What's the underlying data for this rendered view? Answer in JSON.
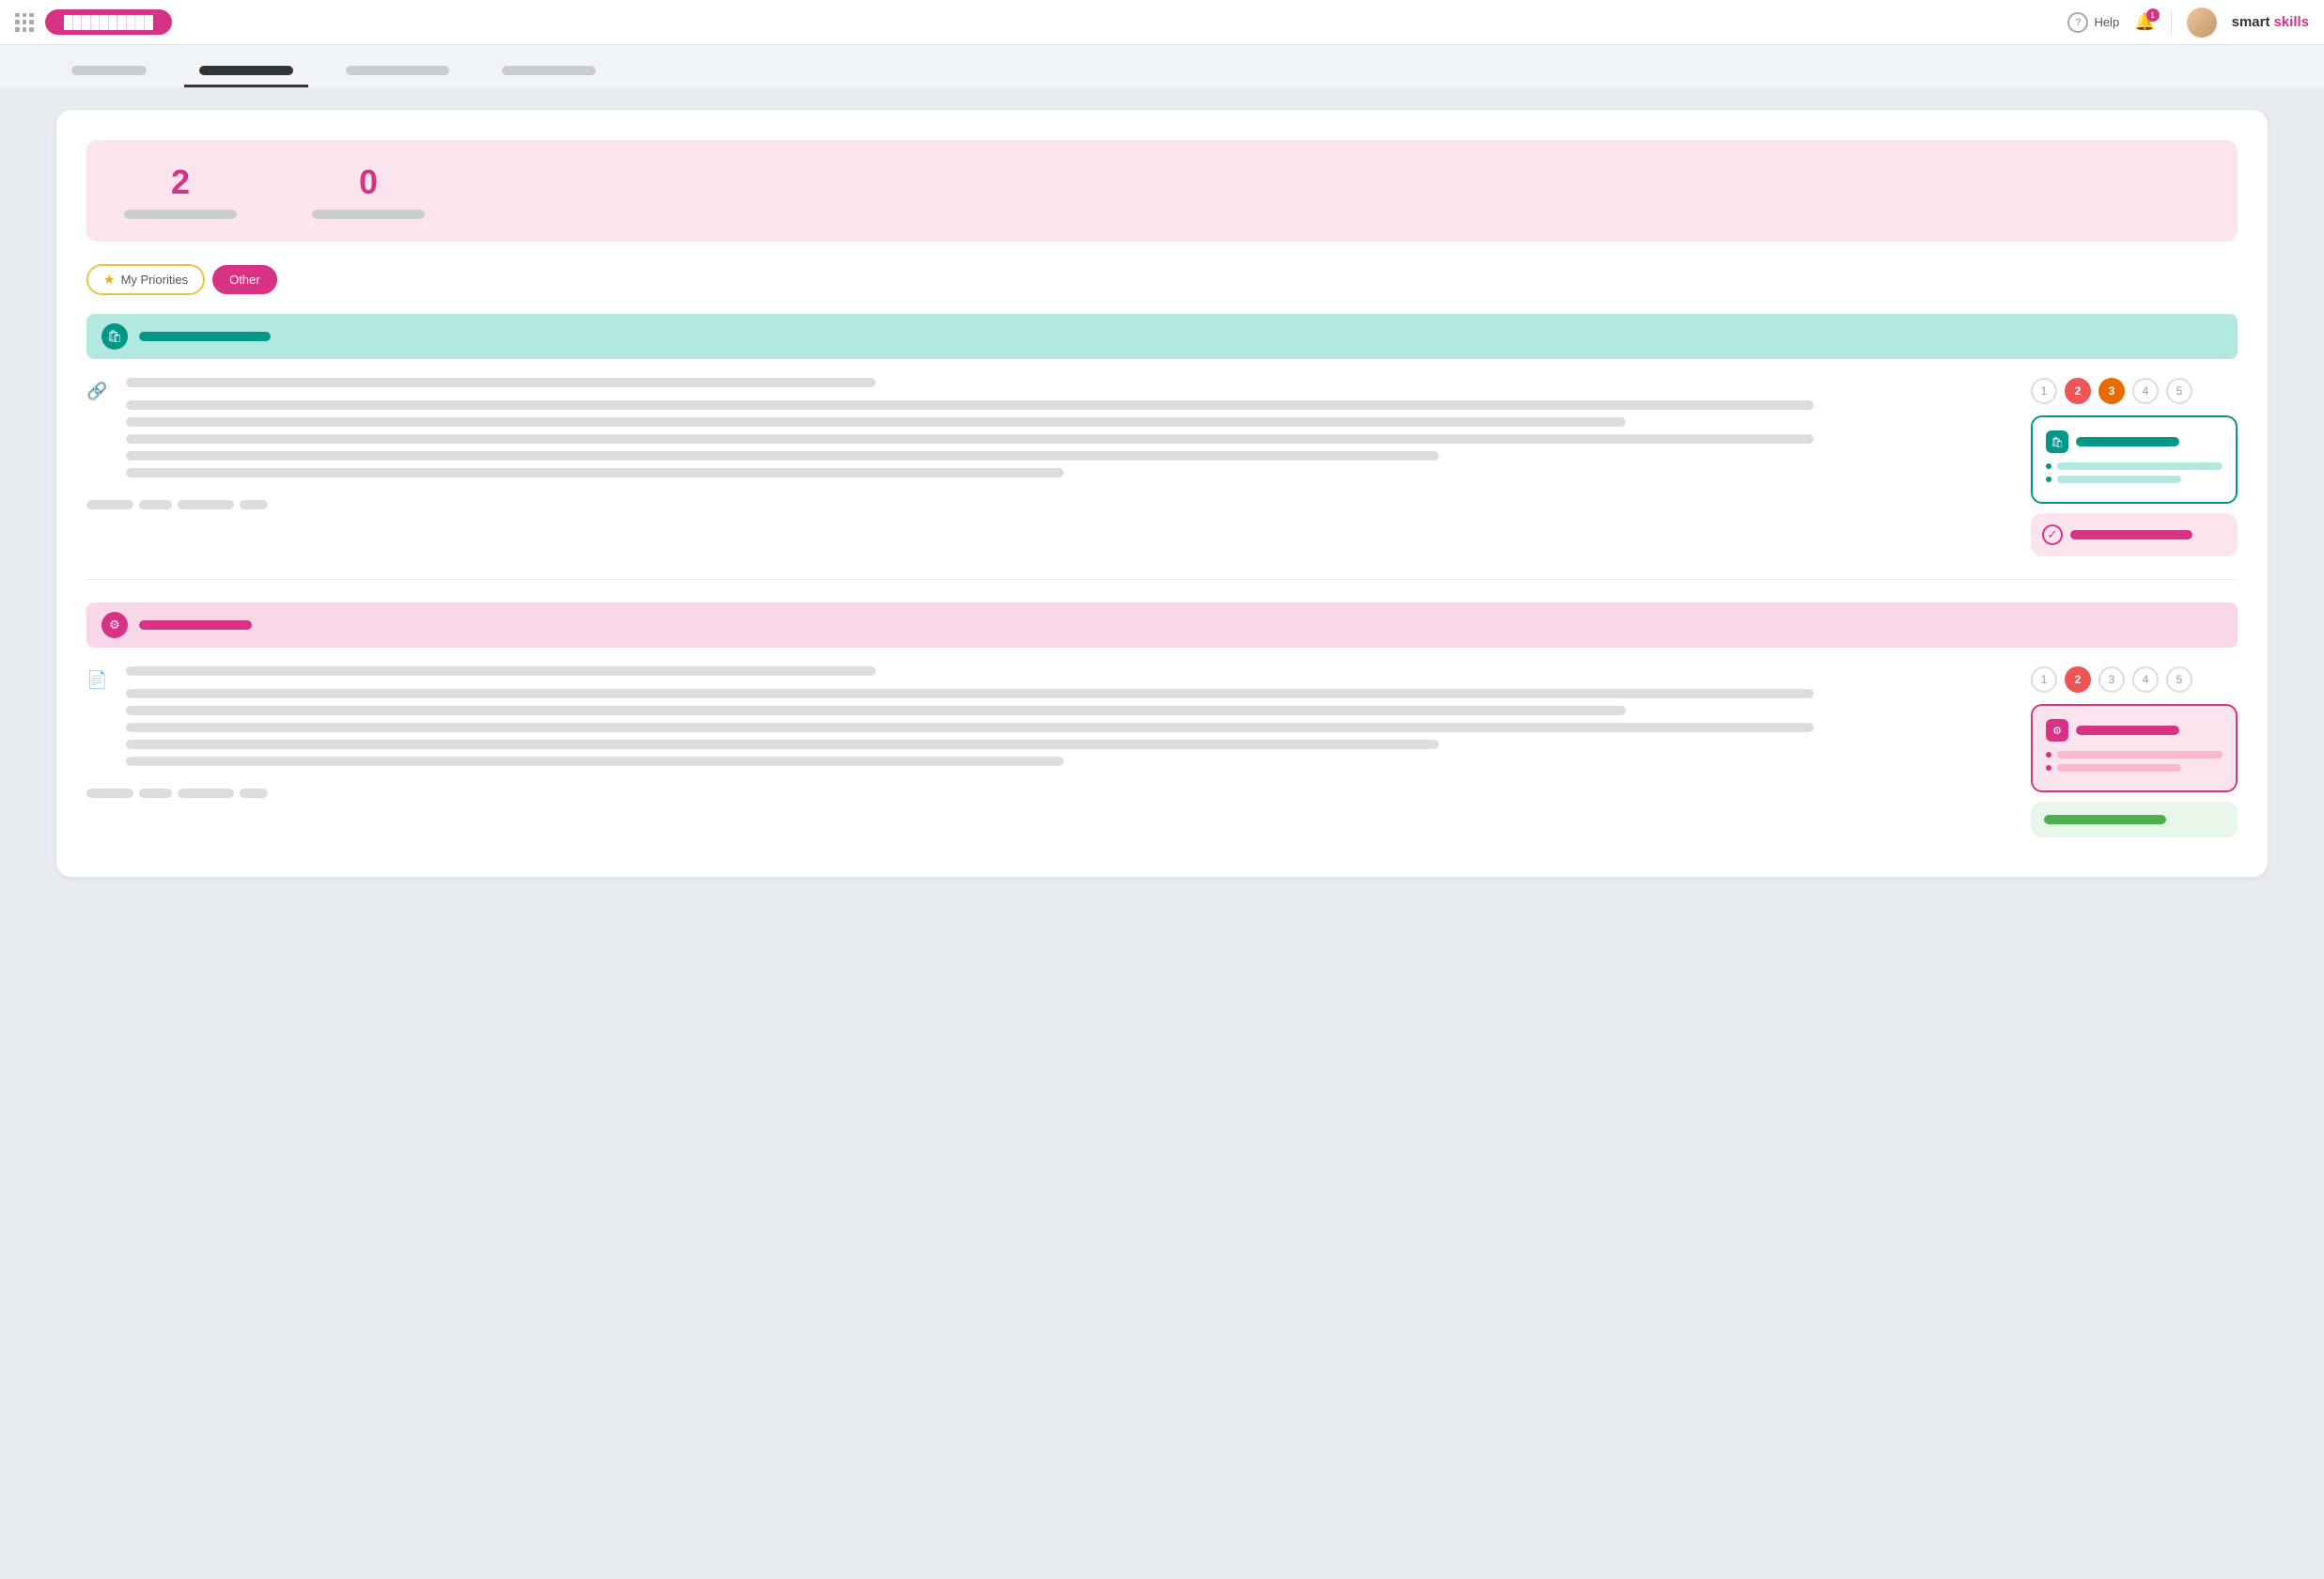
{
  "topnav": {
    "pill_label": "██████████",
    "help_label": "Help",
    "brand": "smartskills"
  },
  "tabs": {
    "items": [
      {
        "label": "████████",
        "active": false
      },
      {
        "label": "██████████",
        "active": true
      },
      {
        "label": "███████████",
        "active": false
      },
      {
        "label": "██████████",
        "active": false
      }
    ]
  },
  "stats": {
    "value1": "2",
    "label1": "",
    "value2": "0",
    "label2": ""
  },
  "filters": {
    "my_priorities": "My Priorities",
    "other": "Other"
  },
  "section1": {
    "label": "██████████"
  },
  "section2": {
    "label": "█████████"
  },
  "pagination1": [
    1,
    2,
    3,
    4,
    5
  ],
  "pagination2": [
    1,
    2,
    3,
    4,
    5
  ],
  "right_card1": {
    "title": "████████████"
  },
  "right_card2": {
    "title": "████████████"
  },
  "check_card": {
    "label": "████████████████"
  },
  "green_card": {
    "label": "████████████"
  }
}
